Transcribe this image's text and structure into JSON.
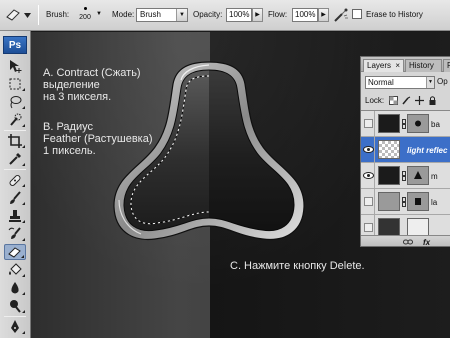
{
  "options_bar": {
    "brush_label": "Brush:",
    "brush_size": "200",
    "mode_label": "Mode:",
    "mode_value": "Brush",
    "opacity_label": "Opacity:",
    "opacity_value": "100%",
    "flow_label": "Flow:",
    "flow_value": "100%",
    "erase_to_history_label": "Erase to History"
  },
  "tools": {
    "logo": "Ps",
    "items": [
      "move-tool",
      "marquee-tool",
      "lasso-tool",
      "quick-selection-tool",
      "crop-tool",
      "eyedropper-tool",
      "healing-brush-tool",
      "brush-tool",
      "clone-stamp-tool",
      "history-brush-tool",
      "eraser-tool",
      "paint-bucket-tool",
      "blur-tool",
      "dodge-tool",
      "pen-tool",
      "type-tool"
    ],
    "active": "eraser-tool"
  },
  "canvas": {
    "note_a": [
      "A. Contract (Сжать)",
      "выделение",
      "на 3 пикселя."
    ],
    "note_b": [
      "B. Радиус",
      "Feather (Растушевка)",
      "1 пиксель."
    ],
    "note_c": "C. Нажмите кнопку Delete."
  },
  "layers_panel": {
    "tabs": [
      "Layers",
      "History",
      "P"
    ],
    "blend_mode": "Normal",
    "opacity_cut": "Op",
    "lock_label": "Lock:",
    "layers": [
      {
        "name": "ba",
        "visible": false,
        "selected": false
      },
      {
        "name": "light reflec",
        "visible": true,
        "selected": true
      },
      {
        "name": "m",
        "visible": true,
        "selected": false
      },
      {
        "name": "la",
        "visible": false,
        "selected": false
      },
      {
        "name": "",
        "visible": false,
        "selected": false
      }
    ],
    "bottom_icons": [
      "link-icon",
      "fx-icon"
    ],
    "bottom_fx": "fx"
  },
  "colors": {
    "selection_blue": "#3c6fc8",
    "ps_logo_blue": "#2a62b0"
  }
}
